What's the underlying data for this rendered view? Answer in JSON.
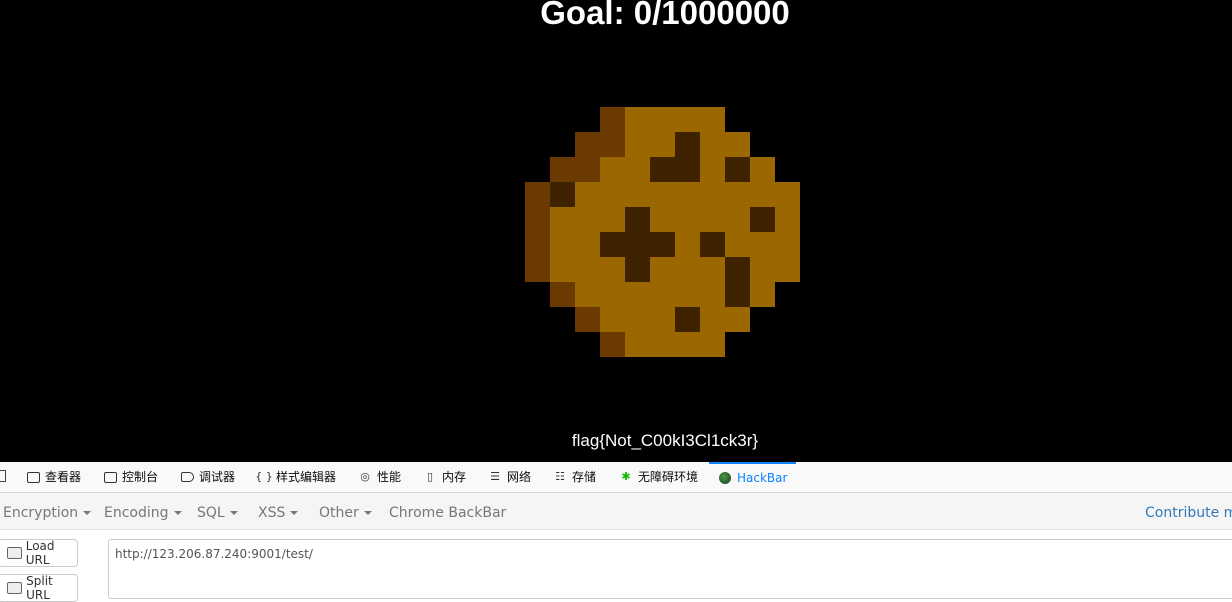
{
  "game": {
    "goal_text": "Goal: 0/1000000",
    "flag_text": "flag{Not_C00kI3Cl1ck3r}",
    "colors": {
      "background": "#000000",
      "cookie_base": "#9a6700",
      "cookie_edge": "#6b3a00",
      "chip": "#3f2200"
    }
  },
  "devtools": {
    "tabs": [
      {
        "label": "查看器",
        "icon": "inspector-icon"
      },
      {
        "label": "控制台",
        "icon": "console-icon"
      },
      {
        "label": "调试器",
        "icon": "debugger-icon"
      },
      {
        "label": "样式编辑器",
        "icon": "style-editor-icon"
      },
      {
        "label": "性能",
        "icon": "performance-icon"
      },
      {
        "label": "内存",
        "icon": "memory-icon"
      },
      {
        "label": "网络",
        "icon": "network-icon"
      },
      {
        "label": "存储",
        "icon": "storage-icon"
      },
      {
        "label": "无障碍环境",
        "icon": "accessibility-icon"
      },
      {
        "label": "HackBar",
        "icon": "hackbar-icon",
        "active": true
      }
    ]
  },
  "hackbar": {
    "menu": [
      {
        "label": "Encryption"
      },
      {
        "label": "Encoding"
      },
      {
        "label": "SQL"
      },
      {
        "label": "XSS"
      },
      {
        "label": "Other"
      },
      {
        "label": "Chrome BackBar"
      }
    ],
    "contribute_label": "Contribute me",
    "load_url_label": "Load URL",
    "split_url_label": "Split URL",
    "url_value": "http://123.206.87.240:9001/test/"
  }
}
